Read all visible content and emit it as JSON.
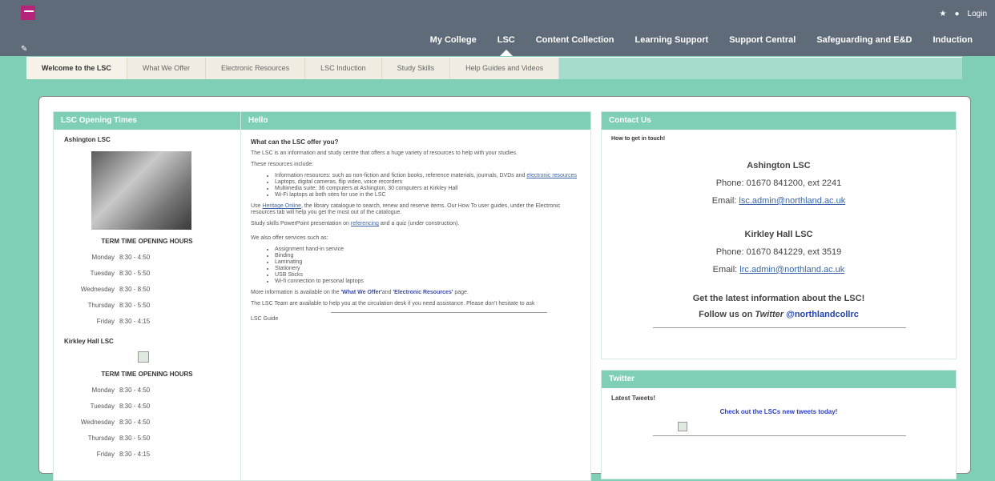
{
  "topbar": {
    "home_label": "",
    "login_label": "Login"
  },
  "mainnav": [
    "My College",
    "LSC",
    "Content Collection",
    "Learning Support",
    "Support Central",
    "Safeguarding and E&D",
    "Induction"
  ],
  "subnav": [
    "Welcome to the LSC",
    "What We Offer",
    "Electronic Resources",
    "LSC Induction",
    "Study Skills",
    "Help Guides and Videos"
  ],
  "left": {
    "header": "LSC Opening Times",
    "ash_title": "Ashington LSC",
    "term_title": "TERM TIME OPENING HOURS",
    "ash_hours": [
      {
        "day": "Monday",
        "time": "8:30 - 4:50"
      },
      {
        "day": "Tuesday",
        "time": "8:30 - 5:50"
      },
      {
        "day": "Wednesday",
        "time": "8:30 - 8:50"
      },
      {
        "day": "Thursday",
        "time": "8:30 - 5:50"
      },
      {
        "day": "Friday",
        "time": "8:30 - 4:15"
      }
    ],
    "kirk_title": "Kirkley Hall LSC",
    "kirk_hours": [
      {
        "day": "Monday",
        "time": "8:30 - 4:50"
      },
      {
        "day": "Tuesday",
        "time": "8:30 - 4:50"
      },
      {
        "day": "Wednesday",
        "time": "8:30 - 4:50"
      },
      {
        "day": "Thursday",
        "time": "8:30 - 5:50"
      },
      {
        "day": "Friday",
        "time": "8:30 - 4:15"
      }
    ]
  },
  "mid": {
    "header": "Hello",
    "q": "What can the LSC offer you?",
    "intro": "The LSC is an information and study centre that offers a huge variety of resources to help with your studies.",
    "res_title": "These resources include:",
    "res_item1_pre": "Information resources: such as non-fiction and fiction books, reference materials, journals, DVDs and ",
    "res_item1_link": "electronic resources",
    "res_item2": "Laptops, digital cameras, flip video, voice recorders",
    "res_item3": "Multimedia suite: 36 computers at Ashington, 30 computers at Kirkley Hall",
    "res_item4": "Wi-Fi laptops at both sites for use in the LSC",
    "heritage_pre": "Use ",
    "heritage_link": "Heritage Online",
    "heritage_post": ", the library catalogue to search, renew and reserve items. Our How To user guides, under the Electronic resources tab will help you get the most out of the catalogue.",
    "skills_pre": "Study skills PowerPoint presentation on ",
    "skills_link": "referencing",
    "skills_post": " and a quiz (under construction).",
    "services_title": "We also offer services such as:",
    "services": [
      "Assignment hand-in service",
      "Binding",
      "Laminating",
      "Stationery",
      "USB Sticks",
      "Wi-fi connection to personal laptops"
    ],
    "more_pre": "More information is available on the ",
    "more_link1": "'What We Offer'",
    "more_mid": "and ",
    "more_link2": "'Electronic Resources'",
    "more_post": " page.",
    "team": "The LSC Team are available to help you at the circulation desk if you need assistance.  Please don't hesitate to ask",
    "guide": "LSC Guide"
  },
  "contact": {
    "header": "Contact Us",
    "how": "How to get in touch!",
    "ash_title": "Ashington LSC",
    "ash_phone": "Phone: 01670 841200, ext 2241",
    "ash_email_label": "Email: ",
    "ash_email": "lsc.admin@northland.ac.uk",
    "kirk_title": "Kirkley Hall LSC",
    "kirk_phone": "Phone: 01670 841229, ext 3519",
    "kirk_email_label": "Email: ",
    "kirk_email": "lrc.admin@northland.ac.uk",
    "latest": "Get the latest information about the LSC!",
    "follow_pre": "Follow us on ",
    "follow_twitter": "Twitter",
    "follow_handle": "@northlandcollrc"
  },
  "twitter": {
    "header": "Twitter",
    "latest": "Latest Tweets!",
    "check": "Check out the LSCs new tweets today!"
  }
}
